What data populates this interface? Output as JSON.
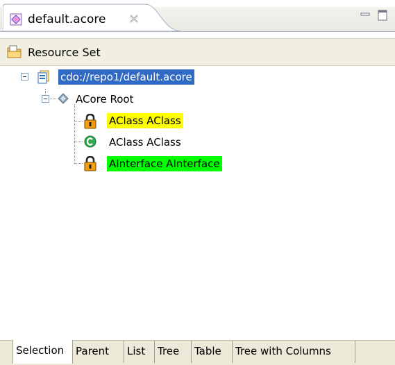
{
  "editor_tab": {
    "title": "default.acore",
    "icon": "acore-file-icon"
  },
  "view_controls": {
    "minimize_icon": "minimize-icon",
    "maximize_icon": "maximize-icon"
  },
  "header": {
    "label": "Resource Set",
    "icon": "resource-set-icon"
  },
  "tree": {
    "resource": {
      "label": "cdo://repo1/default.acore",
      "selected": true
    },
    "root": {
      "label": "ACore Root"
    },
    "items": [
      {
        "label": "AClass AClass",
        "icon": "lock-icon",
        "highlight": "#ffff00"
      },
      {
        "label": "AClass AClass",
        "icon": "class-c-icon",
        "highlight": ""
      },
      {
        "label": "AInterface AInterface",
        "icon": "lock-icon",
        "highlight": "#00ff00"
      }
    ]
  },
  "colors": {
    "selection": "#316ac5",
    "yellow": "#ffff00",
    "green": "#00ff00"
  },
  "bottom_tabs": [
    {
      "label": "Selection",
      "active": true
    },
    {
      "label": "Parent",
      "active": false
    },
    {
      "label": "List",
      "active": false
    },
    {
      "label": "Tree",
      "active": false
    },
    {
      "label": "Table",
      "active": false
    },
    {
      "label": "Tree with Columns",
      "active": false
    }
  ]
}
